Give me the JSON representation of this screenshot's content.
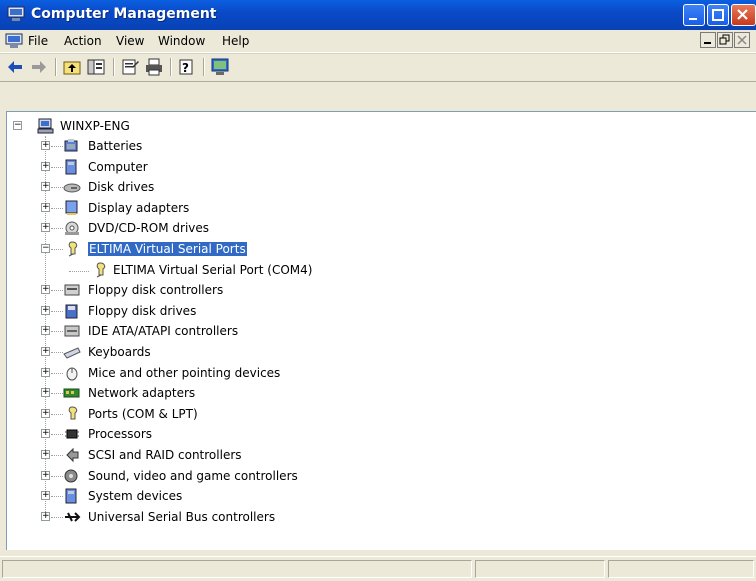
{
  "window": {
    "title": "Computer Management"
  },
  "menu": [
    "File",
    "Action",
    "View",
    "Window",
    "Help"
  ],
  "toolbar": {
    "buttons": [
      "back-icon",
      "forward-icon",
      "up-folder-icon",
      "show-hide-tree-icon",
      "properties-icon",
      "print-icon",
      "help-icon",
      "console-icon"
    ]
  },
  "tree": {
    "root": "WINXP-ENG",
    "items": [
      {
        "label": "Batteries",
        "icon": "battery-icon",
        "expanded": false
      },
      {
        "label": "Computer",
        "icon": "computer-icon",
        "expanded": false
      },
      {
        "label": "Disk drives",
        "icon": "disk-drive-icon",
        "expanded": false
      },
      {
        "label": "Display adapters",
        "icon": "display-adapter-icon",
        "expanded": false
      },
      {
        "label": "DVD/CD-ROM drives",
        "icon": "cdrom-icon",
        "expanded": false
      },
      {
        "label": "ELTIMA Virtual Serial Ports",
        "icon": "serial-port-icon",
        "expanded": true,
        "selected": true
      },
      {
        "label": "ELTIMA Virtual Serial Port (COM4)",
        "icon": "serial-port-icon",
        "child": true
      },
      {
        "label": "Floppy disk controllers",
        "icon": "floppy-controller-icon",
        "expanded": false
      },
      {
        "label": "Floppy disk drives",
        "icon": "floppy-drive-icon",
        "expanded": false
      },
      {
        "label": "IDE ATA/ATAPI controllers",
        "icon": "ide-controller-icon",
        "expanded": false
      },
      {
        "label": "Keyboards",
        "icon": "keyboard-icon",
        "expanded": false
      },
      {
        "label": "Mice and other pointing devices",
        "icon": "mouse-icon",
        "expanded": false
      },
      {
        "label": "Network adapters",
        "icon": "network-adapter-icon",
        "expanded": false
      },
      {
        "label": "Ports (COM & LPT)",
        "icon": "port-icon",
        "expanded": false
      },
      {
        "label": "Processors",
        "icon": "processor-icon",
        "expanded": false
      },
      {
        "label": "SCSI and RAID controllers",
        "icon": "scsi-icon",
        "expanded": false
      },
      {
        "label": "Sound, video and game controllers",
        "icon": "sound-icon",
        "expanded": false
      },
      {
        "label": "System devices",
        "icon": "system-device-icon",
        "expanded": false
      },
      {
        "label": "Universal Serial Bus controllers",
        "icon": "usb-icon",
        "expanded": false
      }
    ]
  },
  "colors": {
    "titlebar": "#0a4ac8",
    "selection": "#316ac5",
    "chrome": "#ece9d8"
  }
}
